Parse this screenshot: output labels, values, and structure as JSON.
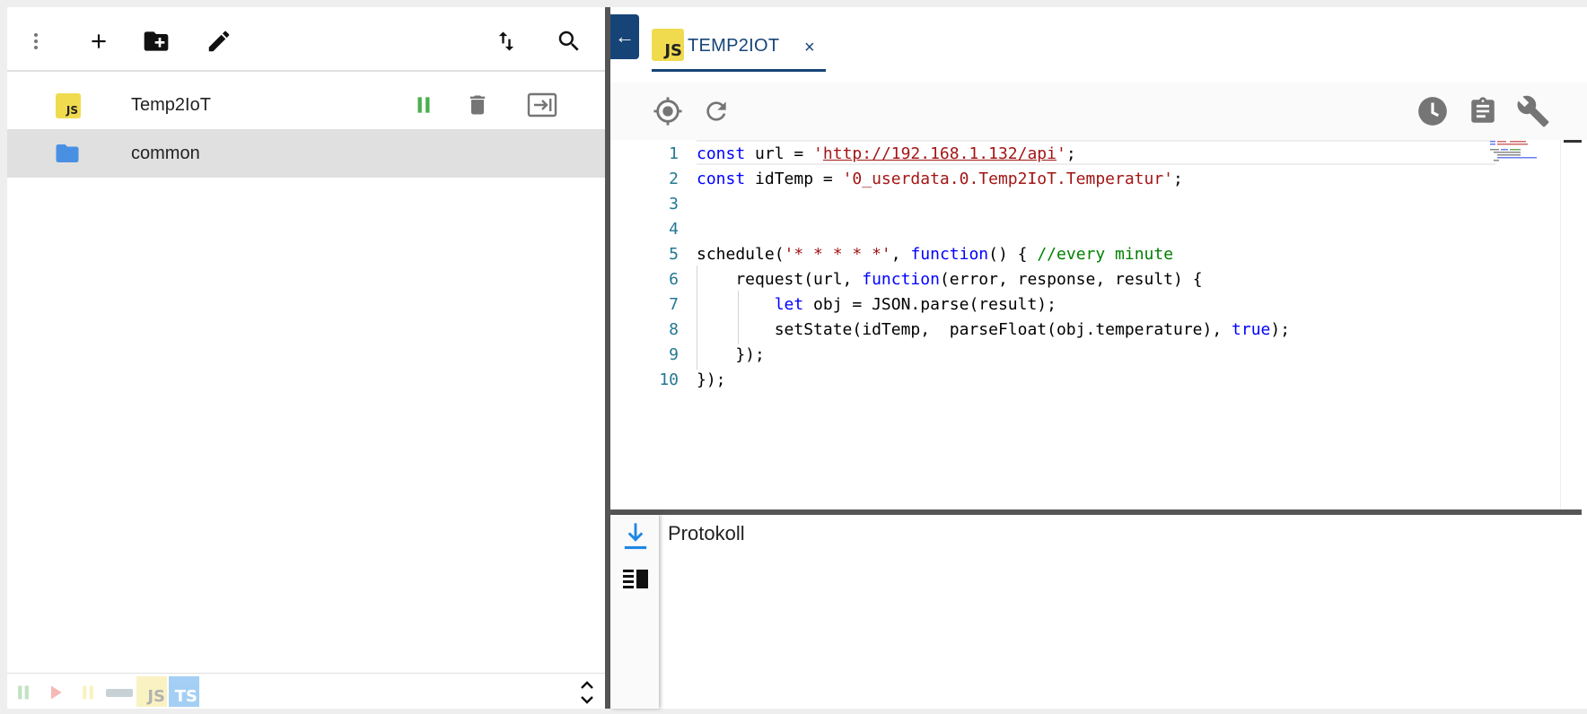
{
  "left_panel": {
    "toolbar": {
      "menu_icon": "more-vert-icon",
      "add_icon": "add-icon",
      "add_folder_icon": "create-new-folder-icon",
      "edit_icon": "edit-icon",
      "sort_icon": "swap-vert-icon",
      "search_icon": "search-icon"
    },
    "items": [
      {
        "name": "Temp2IoT",
        "type": "script",
        "badge": "JS",
        "status": "running"
      },
      {
        "name": "common",
        "type": "folder"
      }
    ],
    "footer": {
      "filters": [
        "pause",
        "play",
        "pause-yellow",
        "blockly",
        "JS",
        "TS"
      ]
    }
  },
  "editor": {
    "tab": {
      "badge": "JS",
      "label": "TEMP2IOT",
      "close": "×"
    },
    "back_icon": "←",
    "lines": [
      {
        "n": "1"
      },
      {
        "n": "2"
      },
      {
        "n": "3"
      },
      {
        "n": "4"
      },
      {
        "n": "5"
      },
      {
        "n": "6"
      },
      {
        "n": "7"
      },
      {
        "n": "8"
      },
      {
        "n": "9"
      },
      {
        "n": "10"
      }
    ],
    "code": {
      "l1_kw": "const",
      "l1_a": " url = ",
      "l1_q1": "'",
      "l1_url": "http://192.168.1.132/api",
      "l1_q2": "'",
      "l1_end": ";",
      "l2_kw": "const",
      "l2_a": " idTemp = ",
      "l2_str": "'0_userdata.0.Temp2IoT.Temperatur'",
      "l2_end": ";",
      "l5_a": "schedule(",
      "l5_str": "'* * * * *'",
      "l5_b": ", ",
      "l5_kw": "function",
      "l5_c": "() { ",
      "l5_cmt": "//every minute",
      "l6_a": "    request(url, ",
      "l6_kw": "function",
      "l6_b": "(error, response, result) {",
      "l7_indent": "        ",
      "l7_kw": "let",
      "l7_a": " obj = JSON.parse(result);",
      "l8_a": "        setState(idTemp,  parseFloat(obj.temperature), ",
      "l8_kw": "true",
      "l8_b": ");",
      "l9_a": "    });",
      "l10_a": "});"
    }
  },
  "log": {
    "title": "Protokoll",
    "scroll_icon": "vertical-align-bottom-icon",
    "layout_icon": "view-list-icon"
  },
  "colors": {
    "accent": "#164477",
    "js_badge": "#f0db4f",
    "running_green": "#4caf50",
    "folder_blue": "#4a90e2",
    "line_number": "#237893"
  }
}
